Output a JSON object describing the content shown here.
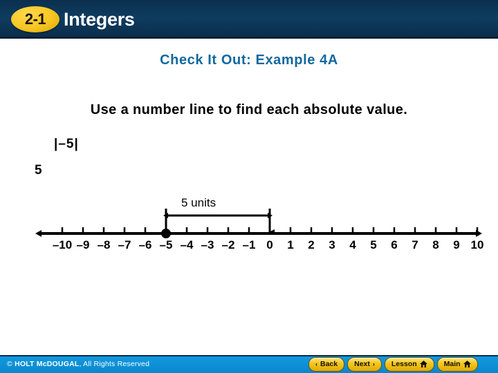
{
  "header": {
    "badge": "2-1",
    "title": "Integers"
  },
  "subtitle": "Check It Out: Example 4A",
  "prompt": "Use a number line to find each absolute value.",
  "expression": "|–5|",
  "answer": "5",
  "diagram": {
    "units_label": "5 units",
    "measure_from": -5,
    "measure_to": 0,
    "point_value": -5,
    "tick_labels": [
      "–10",
      "–9",
      "–8",
      "–7",
      "–6",
      "–5",
      "–4",
      "–3",
      "–2",
      "–1",
      "0",
      "1",
      "2",
      "3",
      "4",
      "5",
      "6",
      "7",
      "8",
      "9",
      "10"
    ],
    "tick_values": [
      -10,
      -9,
      -8,
      -7,
      -6,
      -5,
      -4,
      -3,
      -2,
      -1,
      0,
      1,
      2,
      3,
      4,
      5,
      6,
      7,
      8,
      9,
      10
    ],
    "line_color": "#000000"
  },
  "footer": {
    "copyright_symbol": "©",
    "copyright_brand": "HOLT McDOUGAL",
    "copyright_rest": ", All Rights Reserved",
    "buttons": [
      {
        "label": "Back",
        "left_glyph": "‹",
        "right_glyph": "",
        "home": false
      },
      {
        "label": "Next",
        "left_glyph": "",
        "right_glyph": "›",
        "home": false
      },
      {
        "label": "Lesson",
        "left_glyph": "",
        "right_glyph": "",
        "home": true
      },
      {
        "label": "Main",
        "left_glyph": "",
        "right_glyph": "",
        "home": true
      }
    ]
  },
  "colors": {
    "header_bg": "#0e3c60",
    "badge_yellow": "#f5c521",
    "subtitle_blue": "#12689e",
    "footer_blue": "#0d8ed4"
  }
}
